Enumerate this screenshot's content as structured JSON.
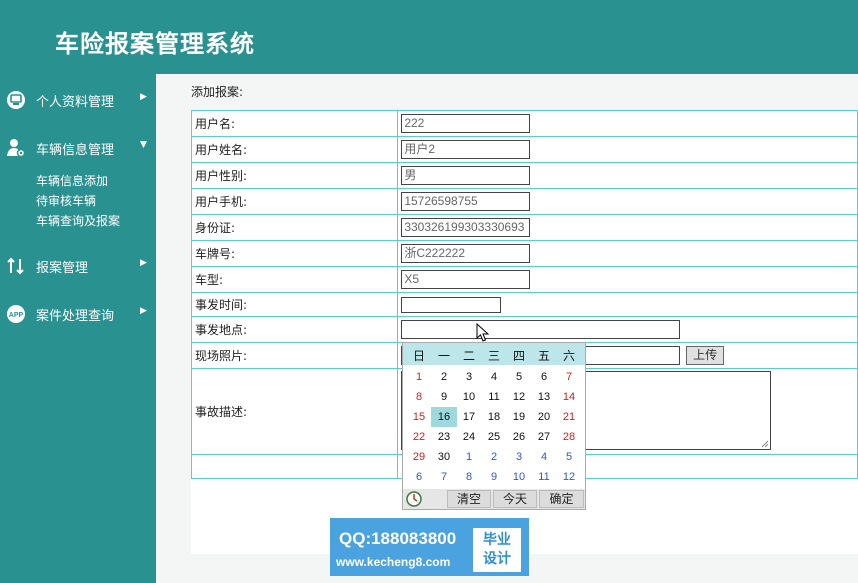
{
  "app": {
    "title": "车险报案管理系统"
  },
  "sidebar": {
    "menus": [
      {
        "label": "个人资料管理",
        "icon": "monitor-icon",
        "arrow": "▶"
      },
      {
        "label": "车辆信息管理",
        "icon": "user-gear-icon",
        "arrow": "▼",
        "subitems": [
          "车辆信息添加",
          "待审核车辆",
          "车辆查询及报案"
        ]
      },
      {
        "label": "报案管理",
        "icon": "exchange-icon",
        "arrow": "▶"
      },
      {
        "label": "案件处理查询",
        "icon": "app-icon",
        "icon_text": "APP",
        "arrow": "▶"
      }
    ]
  },
  "breadcrumb": "添加报案:",
  "form": {
    "rows": [
      {
        "label": "用户名:",
        "value": "222"
      },
      {
        "label": "用户姓名:",
        "value": "用户2"
      },
      {
        "label": "用户性别:",
        "value": "男"
      },
      {
        "label": "用户手机:",
        "value": "15726598755"
      },
      {
        "label": "身份证:",
        "value": "330326199303330693"
      },
      {
        "label": "车牌号:",
        "value": "浙C222222"
      },
      {
        "label": "车型:",
        "value": "X5"
      },
      {
        "label": "事发时间:",
        "value": ""
      },
      {
        "label": "事发地点:",
        "value": ""
      },
      {
        "label": "现场照片:",
        "value": ""
      },
      {
        "label": "事故描述:",
        "value": ""
      }
    ],
    "upload_label": "上传"
  },
  "calendar": {
    "weekdays": [
      "日",
      "一",
      "二",
      "三",
      "四",
      "五",
      "六"
    ],
    "weeks": [
      [
        "1",
        "2",
        "3",
        "4",
        "5",
        "6",
        "7"
      ],
      [
        "8",
        "9",
        "10",
        "11",
        "12",
        "13",
        "14"
      ],
      [
        "15",
        "16",
        "17",
        "18",
        "19",
        "20",
        "21"
      ],
      [
        "22",
        "23",
        "24",
        "25",
        "26",
        "27",
        "28"
      ],
      [
        "29",
        "30",
        "1",
        "2",
        "3",
        "4",
        "5"
      ],
      [
        "6",
        "7",
        "8",
        "9",
        "10",
        "11",
        "12"
      ]
    ],
    "selected": "16",
    "buttons": {
      "clear": "清空",
      "today": "今天",
      "confirm": "确定"
    },
    "colors": {
      "weekend": "#cc2222",
      "weekday": "#111111",
      "other_month": "#3355cc",
      "selected_bg": "#9fd8dd"
    }
  },
  "watermark": {
    "line1": "QQ:188083800",
    "line2": "www.kecheng8.com",
    "badge_1": "毕业",
    "badge_2": "设计"
  },
  "theme": {
    "primary": "#2a9191",
    "table_border": "#55cfd6"
  }
}
